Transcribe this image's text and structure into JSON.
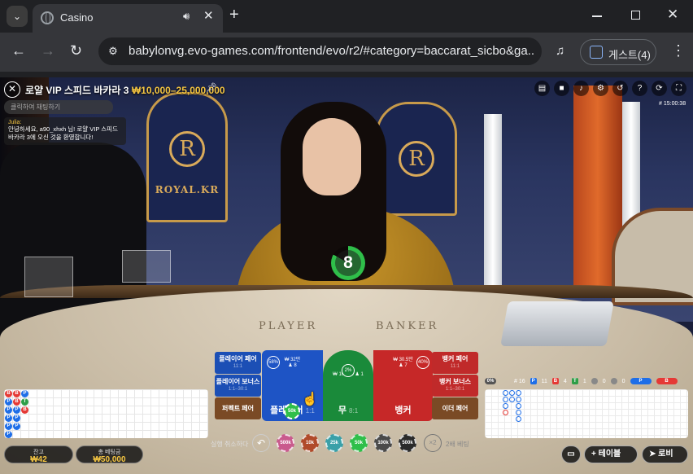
{
  "browser": {
    "tab_title": "Casino",
    "url": "babylonvg.evo-games.com/frontend/evo/r2/#category=baccarat_sicbo&ga...",
    "profile_label": "게스트(4)"
  },
  "game": {
    "table_name": "로얄 VIP 스피드 바카라 3",
    "limits": "₩10,000–25,000,000",
    "game_id": "# 15:00:38",
    "chat_placeholder": "클릭하여 채팅하기",
    "chat_user": "Julia:",
    "chat_message": "안녕하세요, a90_xhxh 님! 로얄 VIP 스피드 바카라 3에 오신 것을 환영합니다!",
    "timer": "8",
    "emblem_text": "ROYAL.KR",
    "table_player": "PLAYER",
    "table_banker": "BANKER"
  },
  "bets": {
    "player_pair": {
      "label": "플레이어 페어",
      "odds": "11:1"
    },
    "player_bonus": {
      "label": "플레이어 보너스",
      "odds": "1:1–30:1"
    },
    "perfect_pair": {
      "label": "퍼펙트 페어"
    },
    "banker_pair": {
      "label": "뱅커 페어",
      "odds": "11:1"
    },
    "banker_bonus": {
      "label": "뱅커 보너스",
      "odds": "1:1–30:1"
    },
    "either_pair": {
      "label": "이더 페어"
    },
    "player": {
      "label": "플레이어",
      "odds": "1:1",
      "stat": "₩ 32만",
      "count": "8",
      "pct": "58%"
    },
    "tie": {
      "label": "무",
      "odds": "8:1",
      "stat": "₩ 10,000",
      "count": "1",
      "pct": "2%"
    },
    "banker": {
      "label": "뱅커",
      "odds": "0.95:1",
      "stat": "₩ 30.5만",
      "count": "7",
      "pct": "40%"
    },
    "placed_chip": "50k"
  },
  "stats": {
    "round": "# 16",
    "player_count": "11",
    "banker_count": "4",
    "tie_count": "1",
    "p_pair": "0",
    "b_pair": "0",
    "pct_small": "0%"
  },
  "footer": {
    "balance_label": "잔고",
    "balance_value": "₩42",
    "total_bet_label": "총 베팅금",
    "total_bet_value": "₩50,000",
    "undo_label": "실행 취소하다",
    "chips": [
      "500k",
      "10k",
      "25k",
      "50k",
      "100k",
      "500k"
    ],
    "x2_label": "2배 베팅",
    "table_btn": "테이블",
    "lobby_btn": "로비"
  },
  "colors": {
    "player_blue": "#1e54c5",
    "banker_red": "#c62828",
    "tie_green": "#1a8a3a",
    "gold": "#f4c542"
  }
}
